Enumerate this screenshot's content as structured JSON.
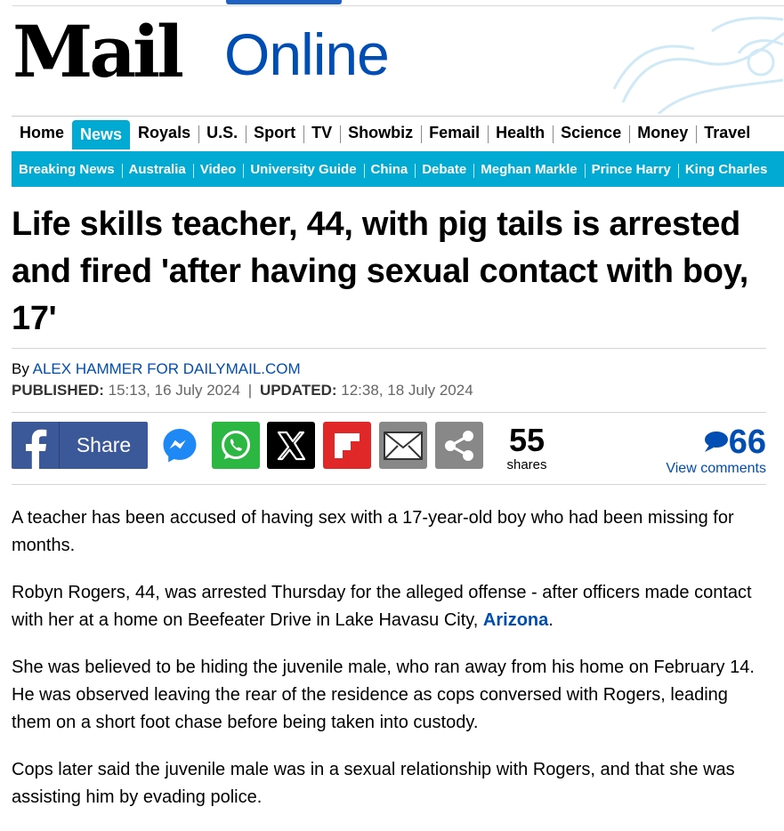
{
  "brand": {
    "mail": "Mail",
    "online": "Online",
    "logo_color": "#000000",
    "online_color": "#004db3"
  },
  "nav": {
    "items": [
      "Home",
      "News",
      "Royals",
      "U.S.",
      "Sport",
      "TV",
      "Showbiz",
      "Femail",
      "Health",
      "Science",
      "Money",
      "Travel"
    ],
    "active": "News",
    "accent": "#00aad2"
  },
  "subnav": {
    "items": [
      "Breaking News",
      "Australia",
      "Video",
      "University Guide",
      "China",
      "Debate",
      "Meghan Markle",
      "Prince Harry",
      "King Charles"
    ]
  },
  "article": {
    "headline": "Life skills teacher, 44, with pig tails is arrested and fired 'after having sexual contact with boy, 17'",
    "byline_prefix": "By",
    "author": "ALEX HAMMER FOR DAILYMAIL.COM",
    "published_label": "PUBLISHED:",
    "published": "15:13, 16 July 2024",
    "separator": "|",
    "updated_label": "UPDATED:",
    "updated": "12:38, 18 July 2024",
    "paragraphs": [
      "A teacher has been accused of having sex with a 17-year-old boy who had been missing for months.",
      "She was believed to be hiding the juvenile male, who ran away from his home on February 14. He was observed leaving the rear of the residence as cops conversed with Rogers, leading them on a short foot chase before being taken into custody.",
      "Cops later said the juvenile male was in a sexual relationship with Rogers, and that she was assisting him by evading police."
    ],
    "p2_text": "Robyn Rogers, 44, was arrested Thursday for the alleged offense - after officers made contact with her at a home on Beefeater Drive in Lake Havasu City,",
    "p2_link": "Arizona",
    "p2_end": "."
  },
  "share": {
    "facebook_label": "Share",
    "buttons": [
      "facebook-icon",
      "messenger-icon",
      "whatsapp-icon",
      "x-icon",
      "flipboard-icon",
      "email-icon",
      "share-icon"
    ],
    "count": "55",
    "count_label": "shares",
    "comments_count": "66",
    "comments_label": "View comments",
    "facebook_color": "#3b5998",
    "whatsapp_color": "#2bb741",
    "flipboard_color": "#e12828"
  }
}
